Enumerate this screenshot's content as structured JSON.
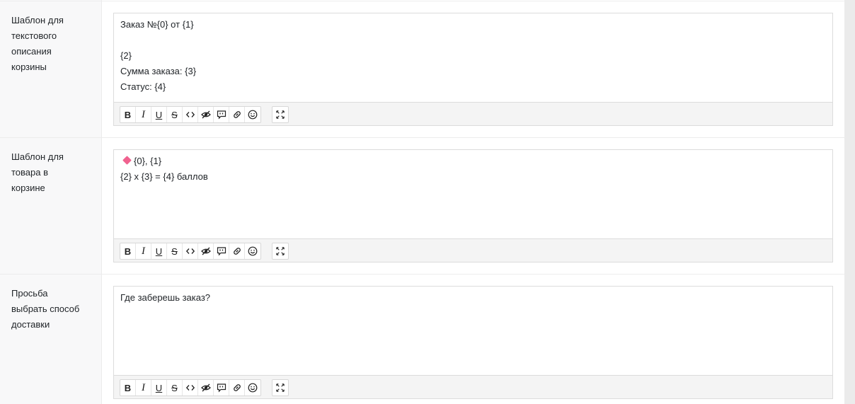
{
  "fields": [
    {
      "label": "Шаблон для\nтекстового\nописания\nкорзины",
      "lines": [
        "Заказ №{0} от {1}",
        "",
        "{2}",
        "Сумма заказа: {3}",
        "Статус: {4}"
      ]
    },
    {
      "label": "Шаблон для\nтовара в\nкорзине",
      "lines": [
        "{0}, {1}",
        "{2} x {3} = {4} баллов"
      ],
      "first_line_icon": "pink-diamond-emoji",
      "icon_color": "#f0628f"
    },
    {
      "label": "Просьба\nвыбрать способ\nдоставки",
      "lines": [
        "Где заберешь заказ?"
      ]
    }
  ],
  "toolbar_buttons": [
    "bold-icon",
    "italic-icon",
    "underline-icon",
    "strikethrough-icon",
    "code-icon",
    "spoiler-icon",
    "quote-icon",
    "link-icon",
    "emoji-icon",
    "fullscreen-icon"
  ],
  "toolbar_glyphs": {
    "bold": "B",
    "italic": "I",
    "underline": "U",
    "strike": "S"
  }
}
